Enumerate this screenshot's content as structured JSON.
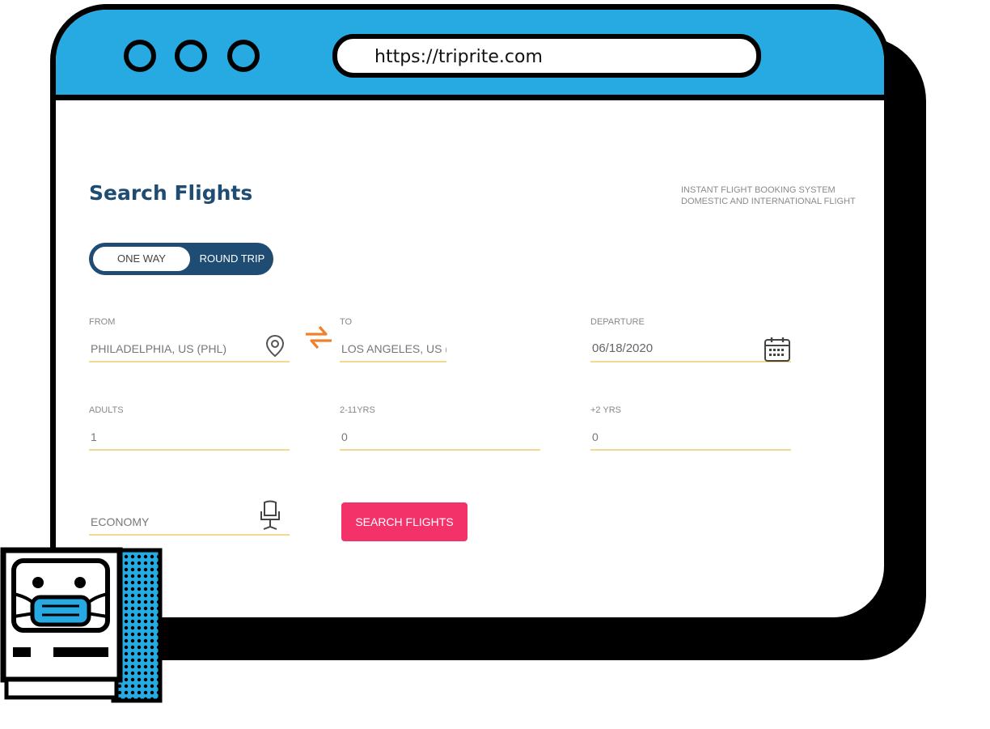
{
  "browser": {
    "url": "https://triprite.com"
  },
  "page": {
    "title": "Search Flights",
    "tagline": [
      "INSTANT FLIGHT BOOKING SYSTEM",
      "DOMESTIC AND INTERNATIONAL FLIGHT"
    ],
    "trip_type": {
      "options": [
        "ONE WAY",
        "ROUND TRIP"
      ]
    },
    "fields": {
      "from": {
        "label": "FROM",
        "value": "PHILADELPHIA, US (PHL)"
      },
      "to": {
        "label": "TO",
        "value": "LOS ANGELES, US ("
      },
      "departure": {
        "label": "DEPARTURE",
        "value": "06/18/2020"
      },
      "adults": {
        "label": "ADULTS",
        "value": "1"
      },
      "children": {
        "label": "2-11YRS",
        "value": "0"
      },
      "infants": {
        "label": "+2 YRS",
        "value": "0"
      },
      "cabin": {
        "value": "ECONOMY"
      }
    },
    "search_button": "SEARCH FLIGHTS"
  },
  "colors": {
    "titlebar": "#27a9e1",
    "heading": "#1e4c72",
    "button": "#f4326a",
    "underline": "#f3d98f",
    "swap_icon": "#f0812a"
  },
  "icons": [
    "location-pin-icon",
    "swap-arrows-icon",
    "calendar-icon",
    "seat-icon",
    "masked-computer-mascot-icon"
  ]
}
